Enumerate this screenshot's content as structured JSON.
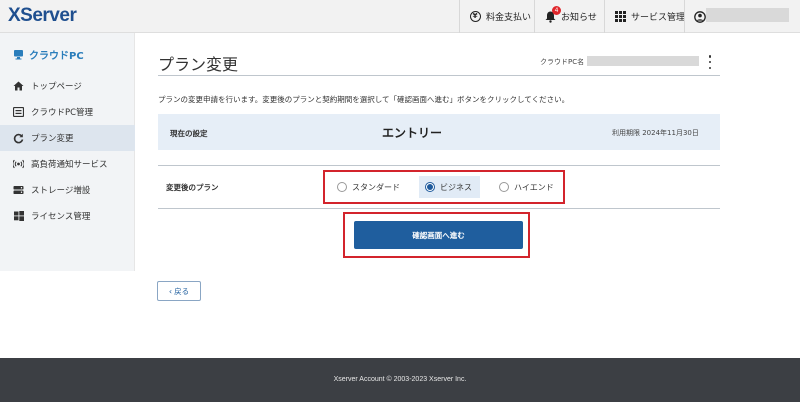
{
  "header": {
    "logo": "XServer",
    "items": [
      {
        "label": "料金支払い",
        "icon": "yen-icon"
      },
      {
        "label": "お知らせ",
        "icon": "bell-icon",
        "badge": "4"
      },
      {
        "label": "サービス管理",
        "icon": "grid-icon"
      }
    ],
    "user_icon": "user-icon"
  },
  "sidebar": {
    "brand": "クラウドPC",
    "items": [
      {
        "label": "トップページ",
        "icon": "home-icon"
      },
      {
        "label": "クラウドPC管理",
        "icon": "list-icon"
      },
      {
        "label": "プラン変更",
        "icon": "refresh-icon",
        "active": true
      },
      {
        "label": "高負荷通知サービス",
        "icon": "signal-icon"
      },
      {
        "label": "ストレージ増設",
        "icon": "storage-icon"
      },
      {
        "label": "ライセンス管理",
        "icon": "windows-icon"
      }
    ]
  },
  "main": {
    "title": "プラン変更",
    "pc_name_label": "クラウドPC名",
    "description": "プランの変更申請を行います。変更後のプランと契約期間を選択して「確認画面へ進む」ボタンをクリックしてください。",
    "current": {
      "label": "現在の設定",
      "plan": "エントリー",
      "expiry": "利用期限 2024年11月30日"
    },
    "after_label": "変更後のプラン",
    "plan_options": [
      {
        "label": "スタンダード",
        "selected": false
      },
      {
        "label": "ビジネス",
        "selected": true
      },
      {
        "label": "ハイエンド",
        "selected": false
      }
    ],
    "confirm_button": "確認画面へ進む",
    "back_button": "戻る"
  },
  "footer": {
    "copyright": "Xserver Account © 2003-2023 Xserver Inc."
  },
  "colors": {
    "brand": "#1f4f8f",
    "accent": "#1f5e9e",
    "highlight_frame": "#d3242c",
    "footer_bg": "#3c3f44"
  }
}
